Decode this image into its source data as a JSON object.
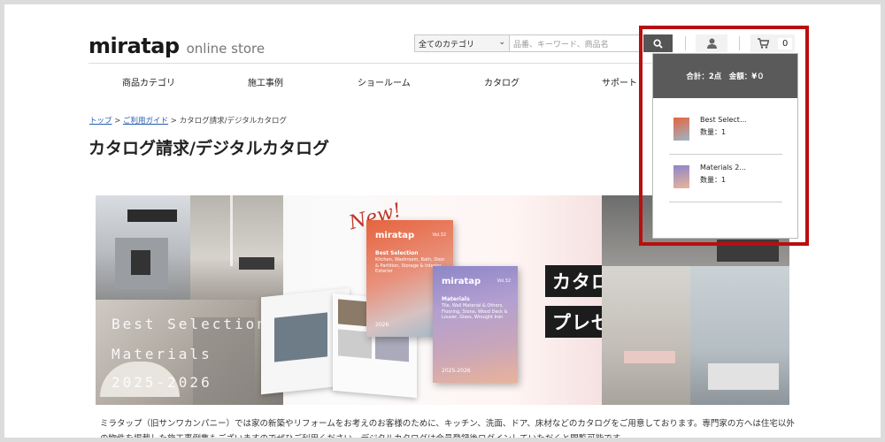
{
  "header": {
    "logo_main": "miratap",
    "logo_sub": "online store",
    "category_select": "全てのカテゴリ",
    "search_placeholder": "品番、キーワード、商品名",
    "cart_count": "0"
  },
  "nav": {
    "items": [
      "商品カテゴリ",
      "施工事例",
      "ショールーム",
      "カタログ",
      "サポート"
    ]
  },
  "breadcrumb": {
    "home": "トップ",
    "sep": ">",
    "guide": "ご利用ガイド",
    "current": "カタログ請求/デジタルカタログ"
  },
  "page_title": "カタログ請求/デジタルカタログ",
  "banner": {
    "left_text_1": "Best Selection",
    "left_text_2": "Materials",
    "left_text_3": "2025-2026",
    "new_label": "New!",
    "tag_1": "カタログ最新号",
    "tag_2": "プレゼント",
    "book1": {
      "logo": "miratap",
      "vol": "Vol.32",
      "head": "Best Selection",
      "body": "Kitchen, Washroom, Bath, Door & Partition, Storage & Interior, Exterior",
      "year": "2026"
    },
    "book2": {
      "logo": "miratap",
      "vol": "Vol.32",
      "head": "Materials",
      "body": "Tile, Wall Material & Others, Flooring, Stone, Wood Deck & Louver, Glass, Wrought Iron",
      "year": "2025-2026"
    }
  },
  "description": "ミラタップ（旧サンワカンパニー）では家の新築やリフォームをお考えのお客様のために、キッチン、洗面、ドア、床材などのカタログをご用意しております。専門家の方へは住宅以外の物件を掲載した施工事例集もございますのでぜひご利用ください。デジタルカタログは会員登録後ログインしていただくと閲覧可能です。",
  "mini_cart": {
    "summary": "合計：2点　金額：¥０",
    "items": [
      {
        "name": "Best Select...",
        "qty": "数量：1"
      },
      {
        "name": "Materials 2...",
        "qty": "数量：1"
      }
    ]
  },
  "colors": {
    "highlight": "#b80f0f",
    "cart_header": "#5a5a5a",
    "search_button": "#555555",
    "link": "#2a5db0"
  }
}
